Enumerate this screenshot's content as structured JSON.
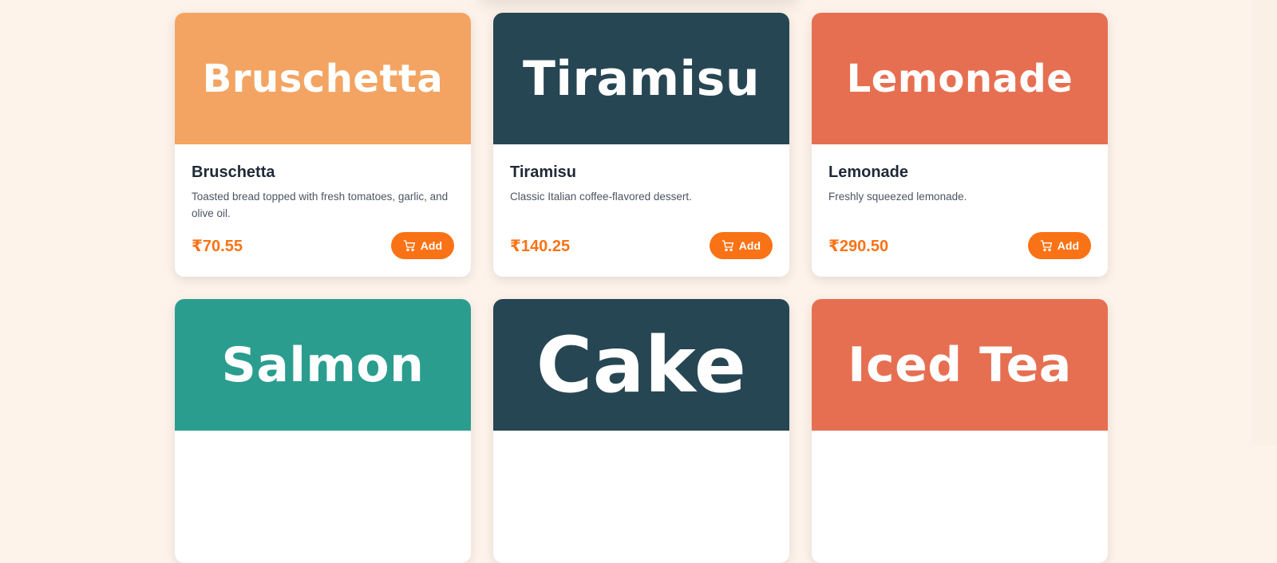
{
  "currency_symbol": "₹",
  "add_label": "Add",
  "items": [
    {
      "banner": "Bruschetta",
      "name": "Bruschetta",
      "description": "Toasted bread topped with fresh tomatoes, garlic, and olive oil.",
      "price": "₹70.55",
      "color": "#f4a462"
    },
    {
      "banner": "Tiramisu",
      "name": "Tiramisu",
      "description": "Classic Italian coffee-flavored dessert.",
      "price": "₹140.25",
      "color": "#264653"
    },
    {
      "banner": "Lemonade",
      "name": "Lemonade",
      "description": "Freshly squeezed lemonade.",
      "price": "₹290.50",
      "color": "#e76f51"
    },
    {
      "banner": "Salmon",
      "color": "#2a9d8f"
    },
    {
      "banner": "Cake",
      "color": "#264653"
    },
    {
      "banner": "Iced Tea",
      "color": "#e76f51"
    }
  ]
}
